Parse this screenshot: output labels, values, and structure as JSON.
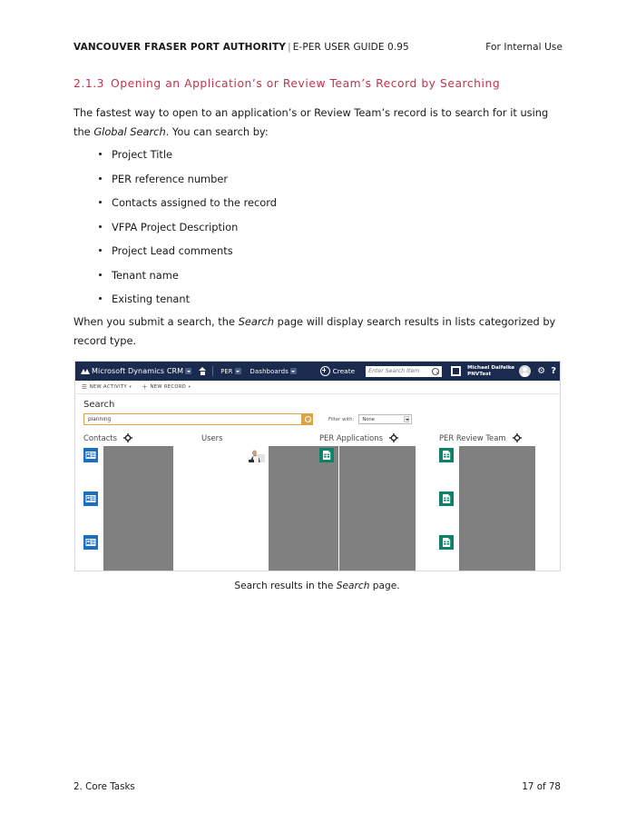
{
  "header": {
    "organization": "VANCOUVER FRASER PORT AUTHORITY",
    "separator": "|",
    "guide": "E-PER USER GUIDE 0.95",
    "classification": "For Internal Use"
  },
  "section": {
    "number": "2.1.3",
    "title": "Opening an Application’s or Review Team’s Record by Searching"
  },
  "intro": {
    "text_part1": "The fastest way to open to an application’s or Review Team’s record is to search for it using the ",
    "emphasis": "Global Search",
    "text_part2": ". You can search by:"
  },
  "search_by_items": [
    {
      "label": "Project Title"
    },
    {
      "label": "PER reference number"
    },
    {
      "label": "Contacts assigned to the record"
    },
    {
      "label": "VFPA Project Description"
    },
    {
      "label": "Project Lead comments"
    },
    {
      "label": "Tenant name"
    },
    {
      "label": "Existing tenant"
    }
  ],
  "outro": {
    "text_part1": "When you submit a search, the ",
    "emphasis": "Search",
    "text_part2": " page will display search results in lists categorized by record type."
  },
  "figure": {
    "caption_part1": "Search results in the ",
    "caption_emphasis": "Search",
    "caption_part2": " page.",
    "crm": {
      "nav": {
        "product_name": "Microsoft Dynamics CRM",
        "area": "PER",
        "dashboards": "Dashboards",
        "create_label": "Create",
        "global_search_placeholder": "Enter Search Item",
        "global_search_value": "",
        "user_name": "Michael Dalfelke",
        "user_org": "PNVTest",
        "gear_glyph": "⚙",
        "help_glyph": "?"
      },
      "commandbar": [
        {
          "label": "NEW ACTIVITY",
          "glyph": "☰"
        },
        {
          "label": "NEW RECORD",
          "glyph": "＋"
        }
      ],
      "search_panel": {
        "heading": "Search",
        "query_value": "planning",
        "filter_label": "Filter with:",
        "filter_value": "None"
      },
      "result_columns": [
        {
          "title": "Contacts",
          "record_icon": "contact-card-icon",
          "icon_color": "#1b6ec2",
          "rows": 3
        },
        {
          "title": "Users",
          "record_icon": "user-photo-icon",
          "icon_color": "#c8b49a",
          "rows": 1
        },
        {
          "title": "PER Applications",
          "record_icon": "application-document-icon",
          "icon_color": "#0d8268",
          "rows": 1
        },
        {
          "title": "PER Review Team",
          "record_icon": "review-team-document-icon",
          "icon_color": "#0d8268",
          "rows": 3
        }
      ]
    }
  },
  "footer": {
    "chapter": "2. Core Tasks",
    "page": "17 of 78"
  },
  "colors": {
    "heading_red": "#c0334d",
    "crm_nav_blue": "#1a2b4f",
    "search_gold": "#d9a441",
    "redaction_gray": "#808080"
  }
}
